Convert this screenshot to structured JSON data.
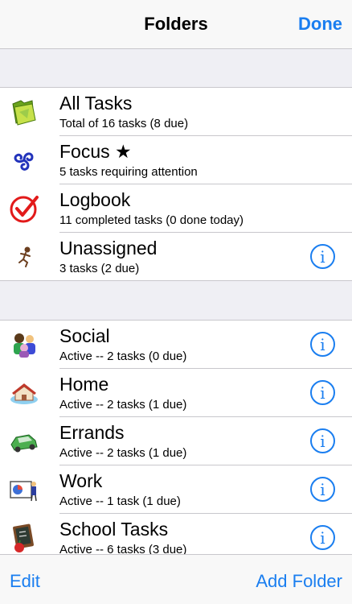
{
  "nav": {
    "title": "Folders",
    "done_label": "Done"
  },
  "system_folders": [
    {
      "title": "All Tasks",
      "subtitle": "Total of 16 tasks (8 due)",
      "icon": "folders-icon"
    },
    {
      "title": "Focus ★",
      "subtitle": "5 tasks requiring attention",
      "icon": "triskelion-icon"
    },
    {
      "title": "Logbook",
      "subtitle": "11 completed tasks (0 done today)",
      "icon": "checkmark-icon"
    },
    {
      "title": "Unassigned",
      "subtitle": "3 tasks (2 due)",
      "icon": "running-person-icon"
    }
  ],
  "user_folders": [
    {
      "title": "Social",
      "subtitle": "Active -- 2 tasks (0 due)",
      "icon": "people-icon"
    },
    {
      "title": "Home",
      "subtitle": "Active -- 2 tasks (1 due)",
      "icon": "house-icon"
    },
    {
      "title": "Errands",
      "subtitle": "Active -- 2 tasks (1 due)",
      "icon": "car-icon"
    },
    {
      "title": "Work",
      "subtitle": "Active -- 1 task (1 due)",
      "icon": "presentation-icon"
    },
    {
      "title": "School Tasks",
      "subtitle": "Active -- 6 tasks (3 due)",
      "icon": "chalkboard-icon"
    }
  ],
  "info_glyph": "i",
  "toolbar": {
    "edit_label": "Edit",
    "add_folder_label": "Add Folder"
  },
  "colors": {
    "accent": "#1a7ef0",
    "group_bg": "#efeff4",
    "separator": "#c8c7cc"
  }
}
